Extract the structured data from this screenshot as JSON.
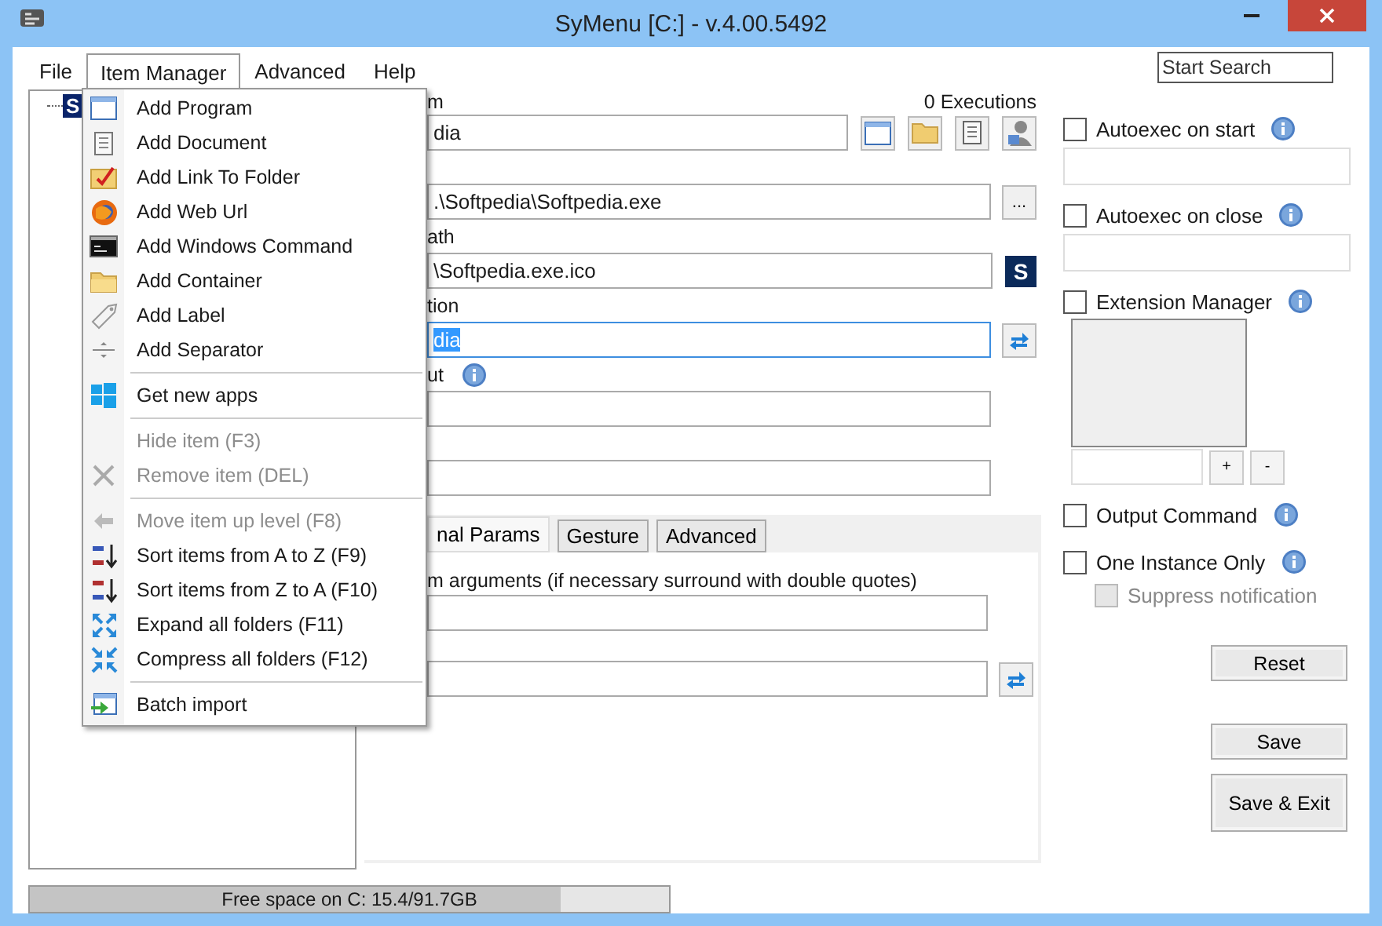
{
  "window": {
    "title": "SyMenu [C:] - v.4.00.5492"
  },
  "menu_bar": [
    {
      "label": "File",
      "selected": false
    },
    {
      "label": "Item Manager",
      "selected": true
    },
    {
      "label": "Advanced",
      "selected": false
    },
    {
      "label": "Help",
      "selected": false
    }
  ],
  "search": {
    "placeholder": "Start Search"
  },
  "menu": [
    {
      "kind": "item",
      "label": "Add Program",
      "disabled": false
    },
    {
      "kind": "item",
      "label": "Add Document",
      "disabled": false
    },
    {
      "kind": "item",
      "label": "Add Link To Folder",
      "disabled": false
    },
    {
      "kind": "item",
      "label": "Add Web Url",
      "disabled": false
    },
    {
      "kind": "item",
      "label": "Add Windows Command",
      "disabled": false
    },
    {
      "kind": "item",
      "label": "Add Container",
      "disabled": false
    },
    {
      "kind": "item",
      "label": "Add Label",
      "disabled": false
    },
    {
      "kind": "item",
      "label": "Add Separator",
      "disabled": false
    },
    {
      "kind": "separator"
    },
    {
      "kind": "item",
      "label": "Get new apps",
      "disabled": false
    },
    {
      "kind": "separator"
    },
    {
      "kind": "item",
      "label": "Hide item (F3)",
      "disabled": true
    },
    {
      "kind": "item",
      "label": "Remove item (DEL)",
      "disabled": true
    },
    {
      "kind": "separator"
    },
    {
      "kind": "item",
      "label": "Move item up level (F8)",
      "disabled": true
    },
    {
      "kind": "item",
      "label": "Sort items from A to Z (F9)",
      "disabled": false
    },
    {
      "kind": "item",
      "label": "Sort items from Z to A (F10)",
      "disabled": false
    },
    {
      "kind": "item",
      "label": "Expand all folders (F11)",
      "disabled": false
    },
    {
      "kind": "item",
      "label": "Compress all folders (F12)",
      "disabled": false
    },
    {
      "kind": "separator"
    },
    {
      "kind": "item",
      "label": "Batch import",
      "disabled": false
    }
  ],
  "tree": {
    "items": [
      {
        "label": "S",
        "selected": true
      }
    ]
  },
  "form": {
    "executions": "0 Executions",
    "rows": [
      {
        "label": "m",
        "value": "dia",
        "focused": false,
        "info": false,
        "kind": "icon_set"
      },
      {
        "value": ".\\Softpedia\\Softpedia.exe",
        "focused": false,
        "info": false,
        "kind": "browse",
        "button_label": "..."
      },
      {
        "label": "ath",
        "value": "\\Softpedia.exe.ico",
        "focused": false,
        "info": false,
        "kind": "app_icon",
        "button_label": "S"
      },
      {
        "label": "tion",
        "value": "dia",
        "focused": true,
        "info": false,
        "kind": "refresh"
      },
      {
        "label": "ut",
        "focused": false,
        "info": true
      },
      {
        "focused": false,
        "info": false
      }
    ]
  },
  "tabs": [
    {
      "label": "nal Params",
      "selected": true
    },
    {
      "label": "Gesture",
      "selected": false
    },
    {
      "label": "Advanced",
      "selected": false
    }
  ],
  "tab_rows": [
    {
      "label": "m arguments (if necessary surround with double quotes)",
      "focused": false,
      "info": false
    },
    {
      "focused": false,
      "info": false,
      "kind": "refresh"
    }
  ],
  "options": [
    {
      "label": "Autoexec on start",
      "checked": false,
      "disabled": false,
      "info": true,
      "kind": "field"
    },
    {
      "label": "Autoexec on close",
      "checked": false,
      "disabled": false,
      "info": true,
      "kind": "field"
    },
    {
      "label": "Extension Manager",
      "checked": false,
      "disabled": false,
      "info": true,
      "kind": "extension_list"
    },
    {
      "label": "Output Command",
      "checked": false,
      "disabled": false,
      "info": true
    },
    {
      "label": "One Instance Only",
      "checked": false,
      "disabled": false,
      "info": true,
      "children": [
        {
          "label": "Suppress notification",
          "checked": false,
          "disabled": true,
          "info": false
        }
      ]
    }
  ],
  "extension_buttons": [
    "+",
    "-"
  ],
  "buttons": [
    "Reset",
    "Save",
    "Save & Exit"
  ],
  "status": {
    "text": "Free space on C: 15.4/91.7GB",
    "level": 0.83
  }
}
